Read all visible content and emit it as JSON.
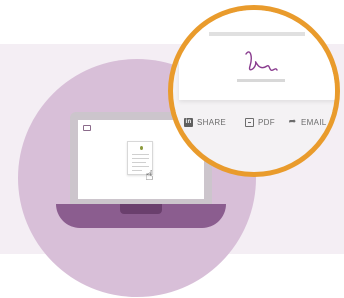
{
  "colors": {
    "band": "#f4eef4",
    "circle": "#d8bfd8",
    "laptop": "#8b5d8f",
    "accent_ring": "#e99b2c",
    "signature": "#8a3d8f"
  },
  "icons": {
    "mail": "mail-icon",
    "cursor": "hand-cursor-icon",
    "linkedin": "linkedin-icon",
    "pdf": "pdf-file-icon",
    "email": "share-arrow-icon"
  },
  "laptop": {
    "cursor_glyph": "☝"
  },
  "zoom": {
    "actions": {
      "share": {
        "icon_text": "in",
        "label": "SHARE"
      },
      "pdf": {
        "label": "PDF"
      },
      "email": {
        "icon_text": "➦",
        "label": "EMAIL"
      }
    }
  }
}
